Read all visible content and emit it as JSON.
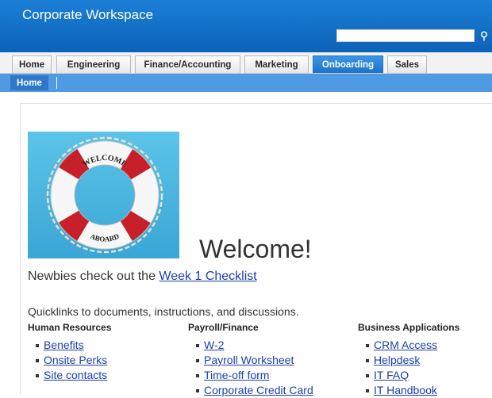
{
  "header": {
    "site_title": "Corporate Workspace",
    "search_value": "",
    "search_icon": "search-icon"
  },
  "tabs": [
    {
      "label": "Home",
      "active": false
    },
    {
      "label": "Engineering",
      "active": false
    },
    {
      "label": "Finance/Accounting",
      "active": false
    },
    {
      "label": "Marketing",
      "active": false
    },
    {
      "label": "Onboarding",
      "active": true
    },
    {
      "label": "Sales",
      "active": false
    }
  ],
  "subnav": {
    "home_label": "Home"
  },
  "hero": {
    "ring_text_top": "WELCOME",
    "ring_text_bottom": "ABOARD"
  },
  "main": {
    "welcome_title": "Welcome!",
    "intro_prefix": "Newbies check out the ",
    "intro_link": "Week 1 Checklist",
    "quicklinks_text": "Quicklinks to documents, instructions, and discussions."
  },
  "columns": [
    {
      "title": "Human Resources",
      "links": [
        "Benefits",
        "Onsite Perks",
        "Site contacts"
      ]
    },
    {
      "title": "Payroll/Finance",
      "links": [
        "W-2",
        "Payroll Worksheet",
        "Time-off form",
        "Corporate Credit Card"
      ]
    },
    {
      "title": "Business Applications",
      "links": [
        "CRM Access",
        "Helpdesk",
        "IT FAQ",
        "IT Handbook"
      ]
    }
  ],
  "colors": {
    "header_blue": "#0c63b8",
    "active_tab": "#1c73c8",
    "subnav_blue": "#4f9ae3",
    "link_blue": "#1a3fa8",
    "hero_sky": "#48b7e0",
    "ring_red": "#c8202a"
  }
}
